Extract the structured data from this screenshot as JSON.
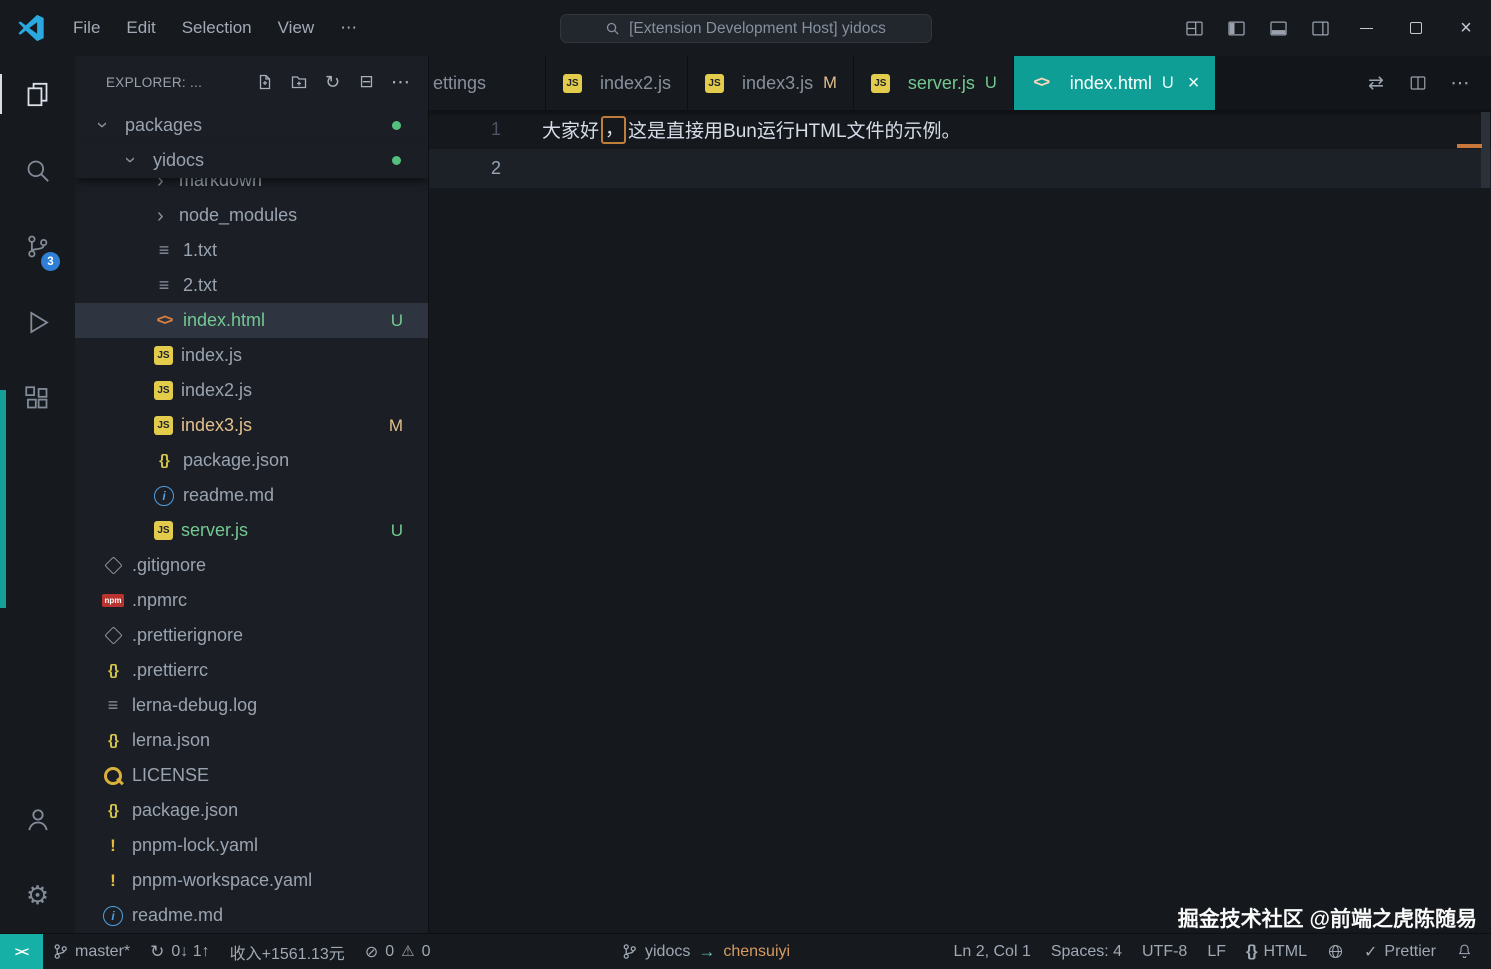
{
  "titlebar": {
    "menus": {
      "file": "File",
      "edit": "Edit",
      "selection": "Selection",
      "view": "View",
      "more": "⋯"
    },
    "command_center": "[Extension Development Host] yidocs"
  },
  "activity_bar": {
    "source_control_badge": "3"
  },
  "explorer": {
    "header": "EXPLORER: ...",
    "tree": {
      "packages": {
        "label": "packages"
      },
      "yidocs": {
        "label": "yidocs"
      },
      "markdown": {
        "label": "markdown"
      },
      "node_modules": {
        "label": "node_modules"
      },
      "file_1_txt": {
        "label": "1.txt"
      },
      "file_2_txt": {
        "label": "2.txt"
      },
      "index_html": {
        "label": "index.html",
        "badge": "U"
      },
      "index_js": {
        "label": "index.js"
      },
      "index2_js": {
        "label": "index2.js"
      },
      "index3_js": {
        "label": "index3.js",
        "badge": "M"
      },
      "package_json": {
        "label": "package.json"
      },
      "readme_md": {
        "label": "readme.md"
      },
      "server_js": {
        "label": "server.js",
        "badge": "U"
      },
      "gitignore": {
        "label": ".gitignore"
      },
      "npmrc": {
        "label": ".npmrc"
      },
      "prettierignore": {
        "label": ".prettierignore"
      },
      "prettierrc": {
        "label": ".prettierrc"
      },
      "lerna_debug_log": {
        "label": "lerna-debug.log"
      },
      "lerna_json": {
        "label": "lerna.json"
      },
      "license": {
        "label": "LICENSE"
      },
      "package_json_root": {
        "label": "package.json"
      },
      "pnpm_lock_yaml": {
        "label": "pnpm-lock.yaml"
      },
      "pnpm_workspace_yaml": {
        "label": "pnpm-workspace.yaml"
      },
      "readme_md_root": {
        "label": "readme.md"
      }
    }
  },
  "tabs": {
    "settings": {
      "label": "ettings"
    },
    "index2_js": {
      "label": "index2.js"
    },
    "index3_js": {
      "label": "index3.js",
      "badge": "M"
    },
    "server_js": {
      "label": "server.js",
      "badge": "U"
    },
    "index_html": {
      "label": "index.html",
      "badge": "U"
    }
  },
  "editor": {
    "line1": {
      "number": "1",
      "text_before": "大家好",
      "boxed_char": "，",
      "text_after": "这是直接用Bun运行HTML文件的示例。"
    },
    "line2": {
      "number": "2"
    }
  },
  "status_bar": {
    "remote_indicator": "><",
    "branch": "master*",
    "sync": "0↓ 1↑",
    "income": "收入+1561.13元",
    "error_count": "0",
    "warning_count": "0",
    "project": "yidocs",
    "arrow": "→",
    "author": "chensuiyi",
    "cursor_position": "Ln 2, Col 1",
    "indentation": "Spaces: 4",
    "encoding": "UTF-8",
    "eol": "LF",
    "language_icon": "{}",
    "language": "HTML",
    "formatter": "Prettier"
  },
  "watermark": "掘金技术社区 @前端之虎陈随易",
  "colors": {
    "active_tab_teal": "#0f9e95",
    "remote_teal": "#16b0a6",
    "git_untracked_green": "#73c991",
    "git_modified_yellow": "#e2c08d",
    "html_icon_orange": "#e0823d",
    "js_icon_yellow": "#e3cb4b",
    "scm_badge_blue": "#2f7fd6",
    "unicode_highlight_orange": "#bf7e3a",
    "author_orange": "#d79b62"
  }
}
